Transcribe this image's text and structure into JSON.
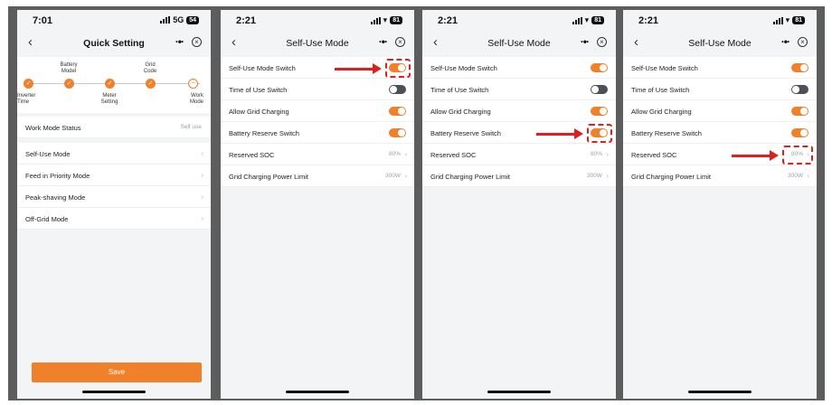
{
  "colors": {
    "accent": "#f0812a",
    "toggle_off": "#4d5059",
    "annotation": "#dd1f1f"
  },
  "screen1": {
    "status": {
      "time": "7:01",
      "network": "5G",
      "battery": "54"
    },
    "nav": {
      "back_icon": "chevron-left-icon",
      "title": "Quick Setting",
      "more_icon": "more-icon",
      "close_icon": "close-circle-icon"
    },
    "steps": [
      {
        "label": "Inverter\nTime",
        "state": "done"
      },
      {
        "label": "Battery\nModel",
        "state": "done"
      },
      {
        "label": "Meter\nSetting",
        "state": "done"
      },
      {
        "label": "Grid\nCode",
        "state": "done"
      },
      {
        "label": "Work\nMode",
        "state": "pending"
      }
    ],
    "status_row": {
      "label": "Work Mode Status",
      "value": "Self use"
    },
    "modes": [
      "Self-Use Mode",
      "Feed in Priority Mode",
      "Peak-shaving Mode",
      "Off-Grid Mode"
    ],
    "save_label": "Save"
  },
  "self_use_screens": [
    {
      "status": {
        "time": "2:21",
        "battery": "81"
      },
      "title": "Self-Use Mode",
      "rows": [
        {
          "label": "Self-Use Mode Switch",
          "type": "toggle",
          "on": true
        },
        {
          "label": "Time of Use Switch",
          "type": "toggle",
          "on": false
        },
        {
          "label": "Allow Grid Charging",
          "type": "toggle",
          "on": true
        },
        {
          "label": "Battery Reserve Switch",
          "type": "toggle",
          "on": true
        },
        {
          "label": "Reserved SOC",
          "type": "value",
          "value": "80%"
        },
        {
          "label": "Grid Charging Power Limit",
          "type": "value",
          "value": "300W"
        }
      ],
      "highlight_row": 0
    },
    {
      "status": {
        "time": "2:21",
        "battery": "81"
      },
      "title": "Self-Use Mode",
      "rows": [
        {
          "label": "Self-Use Mode Switch",
          "type": "toggle",
          "on": true
        },
        {
          "label": "Time of Use Switch",
          "type": "toggle",
          "on": false
        },
        {
          "label": "Allow Grid Charging",
          "type": "toggle",
          "on": true
        },
        {
          "label": "Battery Reserve Switch",
          "type": "toggle",
          "on": true
        },
        {
          "label": "Reserved SOC",
          "type": "value",
          "value": "80%"
        },
        {
          "label": "Grid Charging Power Limit",
          "type": "value",
          "value": "300W"
        }
      ],
      "highlight_row": 3
    },
    {
      "status": {
        "time": "2:21",
        "battery": "81"
      },
      "title": "Self-Use Mode",
      "rows": [
        {
          "label": "Self-Use Mode Switch",
          "type": "toggle",
          "on": true
        },
        {
          "label": "Time of Use Switch",
          "type": "toggle",
          "on": false
        },
        {
          "label": "Allow Grid Charging",
          "type": "toggle",
          "on": true
        },
        {
          "label": "Battery Reserve Switch",
          "type": "toggle",
          "on": true
        },
        {
          "label": "Reserved SOC",
          "type": "value",
          "value": "80%"
        },
        {
          "label": "Grid Charging Power Limit",
          "type": "value",
          "value": "300W"
        }
      ],
      "highlight_row": 4
    }
  ]
}
